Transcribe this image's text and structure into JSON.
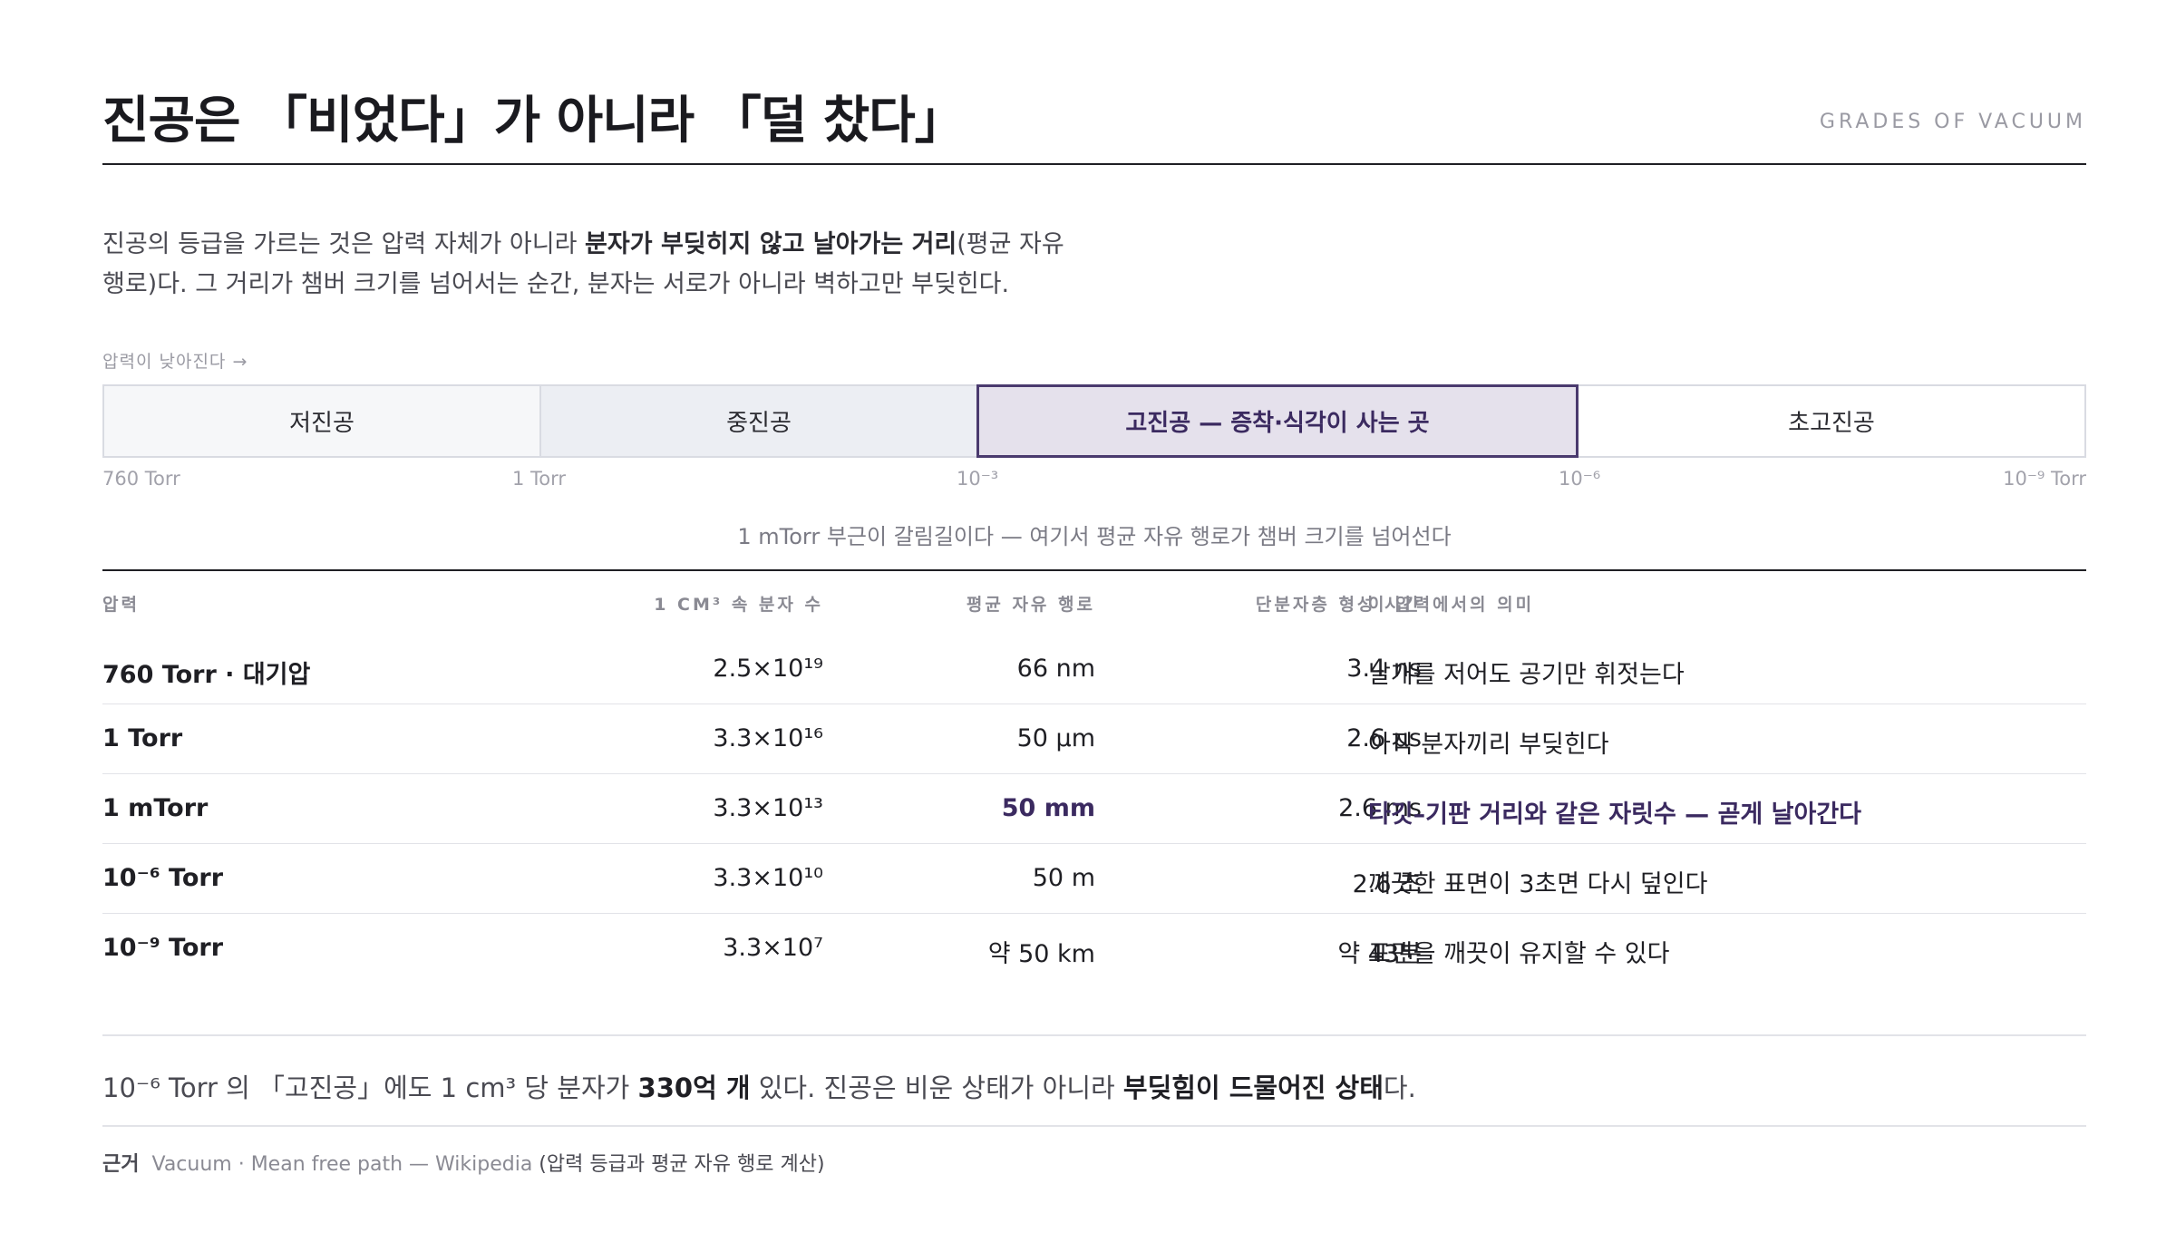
{
  "header": {
    "title": "진공은 「비었다」가 아니라 「덜 찼다」",
    "eyebrow": "GRADES OF VACUUM"
  },
  "intro": {
    "part1": "진공의 등급을 가르는 것은 압력 자체가 아니라 ",
    "emphasis": "분자가 부딪히지 않고 날아가는 거리",
    "part2": "(평균 자유 행로)다. 그 거리가 챔버 크기를 넘어서는 순간, 분자는 서로가 아니라 벽하고만 부딪힌다."
  },
  "band": {
    "caption": "압력이 낮아진다 →",
    "segments": [
      {
        "label": "저진공",
        "fraction": 0.22
      },
      {
        "label": "중진공",
        "fraction": 0.22
      },
      {
        "label": "고진공 — 증착·식각이 사는 곳",
        "fraction": 0.3
      },
      {
        "label": "초고진공",
        "fraction": 0.26
      }
    ],
    "ticks": [
      "760 Torr",
      "1 Torr",
      "10⁻³",
      "10⁻⁶",
      "10⁻⁹ Torr"
    ],
    "note": "1 mTorr 부근이 갈림길이다 — 여기서 평균 자유 행로가 챔버 크기를 넘어선다"
  },
  "table": {
    "headers": [
      "압력",
      "1 CM³ 속 분자 수",
      "평균 자유 행로",
      "단분자층 형성 시간",
      "이 압력에서의 의미"
    ],
    "rows": [
      {
        "pressure": "760 Torr · 대기압",
        "density": "2.5×10¹⁹",
        "mfp": "66 nm",
        "monolayer": "3.4 ns",
        "meaning": "날개를 저어도 공기만 휘젓는다"
      },
      {
        "pressure": "1 Torr",
        "density": "3.3×10¹⁶",
        "mfp": "50 µm",
        "monolayer": "2.6 µs",
        "meaning": "아직 분자끼리 부딪힌다"
      },
      {
        "pressure": "1 mTorr",
        "density": "3.3×10¹³",
        "mfp": "50 mm",
        "monolayer": "2.6 ms",
        "meaning": "타깃–기판 거리와 같은 자릿수 — 곧게 날아간다"
      },
      {
        "pressure": "10⁻⁶ Torr",
        "density": "3.3×10¹⁰",
        "mfp": "50 m",
        "monolayer": "2.6 초",
        "meaning": "깨끗한 표면이 3초면 다시 덮인다"
      },
      {
        "pressure": "10⁻⁹ Torr",
        "density": "3.3×10⁷",
        "mfp": "약 50 km",
        "monolayer": "약 43분",
        "meaning": "표면을 깨끗이 유지할 수 있다"
      }
    ]
  },
  "summary": {
    "part1": "10⁻⁶ Torr 의 「고진공」에도 1 cm³ 당 분자가 ",
    "bold1": "330억 개",
    "part2": " 있다. 진공은 비운 상태가 아니라 ",
    "bold2": "부딪힘이 드물어진 상태",
    "part3": "다."
  },
  "source": {
    "label": "근거",
    "link": "Vacuum · Mean free path — Wikipedia",
    "note": " (압력 등급과 평균 자유 행로 계산)"
  },
  "colors": {
    "accent": "#3b2a60",
    "rule": "#1f1f24",
    "muted": "#9a9aa3"
  }
}
